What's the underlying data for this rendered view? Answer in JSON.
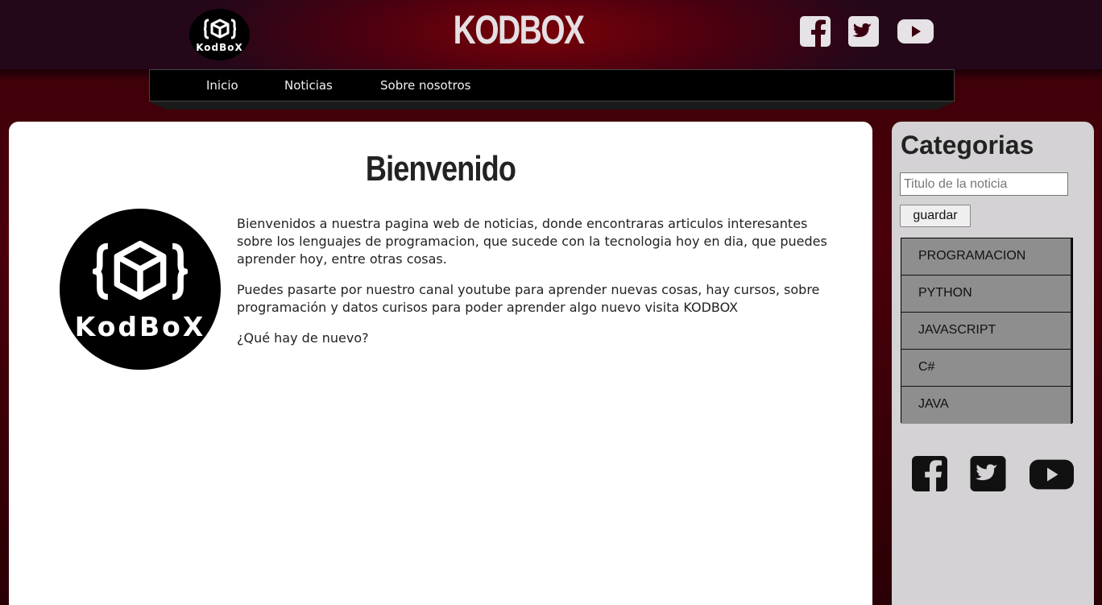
{
  "header": {
    "logo_text": "KodBoX",
    "brand": "KODBOX",
    "social_icons": [
      "facebook-icon",
      "twitter-icon",
      "youtube-icon"
    ]
  },
  "nav": {
    "items": [
      {
        "label": "Inicio"
      },
      {
        "label": "Noticias"
      },
      {
        "label": "Sobre nosotros"
      }
    ]
  },
  "main": {
    "title": "Bienvenido",
    "logo_text": "KodBoX",
    "paragraphs": [
      "Bienvenidos a nuestra pagina web de noticias, donde encontraras articulos interesantes sobre los lenguajes de programacion, que sucede con la tecnologia hoy en dia, que puedes aprender hoy, entre otras cosas.",
      "Puedes pasarte por nuestro canal youtube para aprender nuevas cosas, hay cursos, sobre programación y datos curisos para poder aprender algo nuevo visita KODBOX",
      "¿Qué hay de nuevo?"
    ]
  },
  "sidebar": {
    "title": "Categorias",
    "search_placeholder": "Titulo de la noticia",
    "save_label": "guardar",
    "categories": [
      {
        "label": "PROGRAMACION"
      },
      {
        "label": "PYTHON"
      },
      {
        "label": "JAVASCRIPT"
      },
      {
        "label": "C#"
      },
      {
        "label": "JAVA"
      }
    ]
  },
  "colors": {
    "header_bg": "#4a0010",
    "accent_red": "#7a0208",
    "nav_bg": "#000000",
    "sidebar_bg": "#d4d2d4",
    "category_bg": "#8f8e8f"
  }
}
